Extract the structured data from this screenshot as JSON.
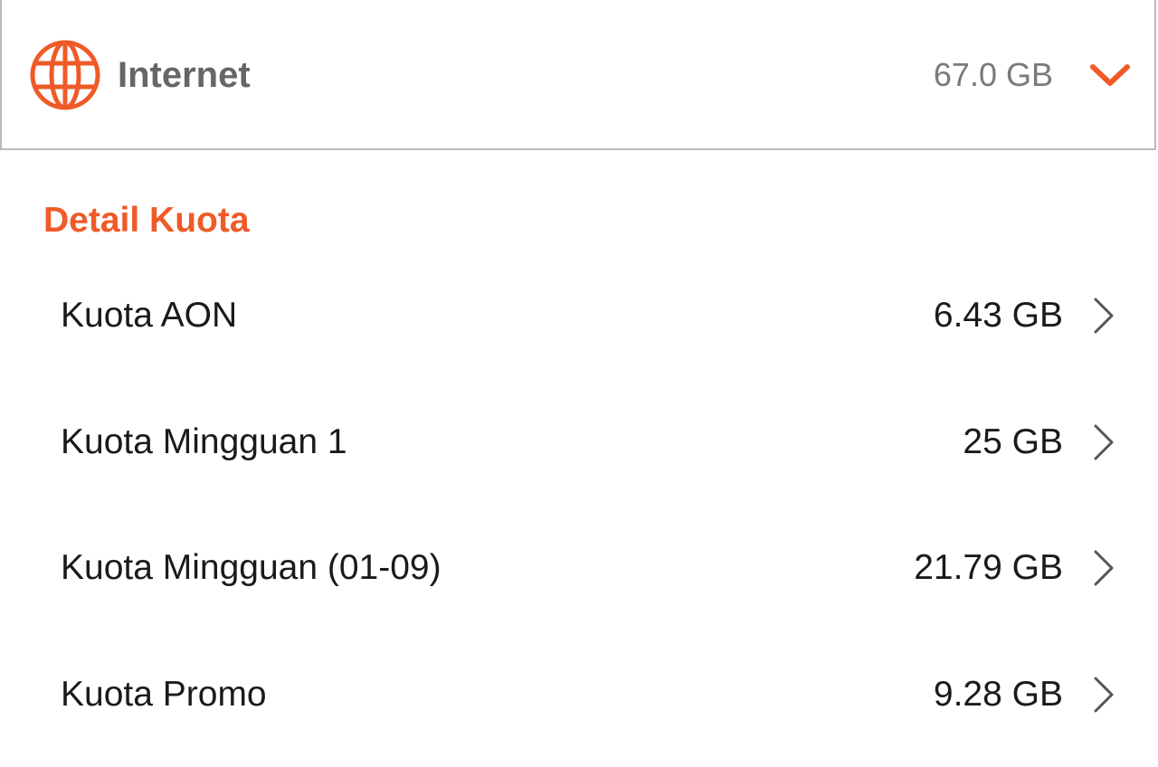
{
  "header": {
    "title": "Internet",
    "total": "67.0 GB",
    "icon": "globe-icon",
    "expand_icon": "chevron-down-icon",
    "accent_color": "#ef5a27"
  },
  "detail": {
    "section_title": "Detail Kuota",
    "items": [
      {
        "label": "Kuota AON",
        "value": "6.43 GB"
      },
      {
        "label": "Kuota Mingguan 1",
        "value": "25 GB"
      },
      {
        "label": "Kuota Mingguan (01-09)",
        "value": "21.79 GB"
      },
      {
        "label": "Kuota Promo",
        "value": "9.28 GB"
      }
    ],
    "item_icon": "chevron-right-icon"
  }
}
